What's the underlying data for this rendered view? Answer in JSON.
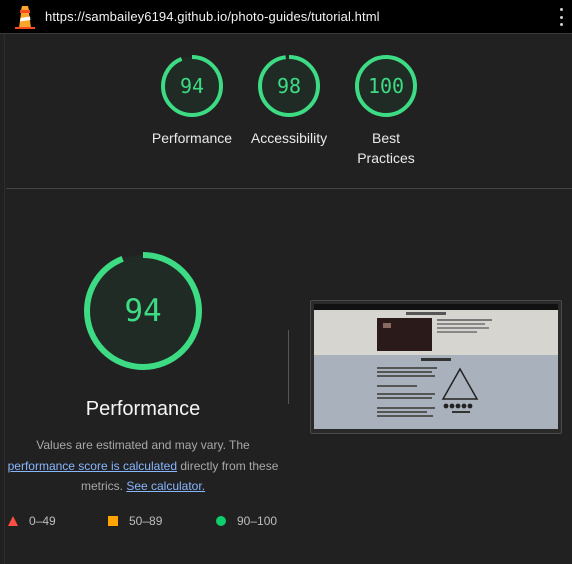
{
  "browser": {
    "url": "https://sambailey6194.github.io/photo-guides/tutorial.html"
  },
  "summary": [
    {
      "score": "94",
      "label": "Performance"
    },
    {
      "score": "98",
      "label": "Accessibility"
    },
    {
      "score": "100",
      "label": "Best Practices"
    }
  ],
  "performance": {
    "score": "94",
    "title": "Performance",
    "desc_1": "Values are estimated and may vary. The",
    "link_score": "performance score is calculated",
    "desc_2": "directly from these metrics.",
    "link_calc": "See calculator."
  },
  "legend": [
    {
      "range": "0–49",
      "color": "#ff4e42"
    },
    {
      "range": "50–89",
      "color": "#ffa400"
    },
    {
      "range": "90–100",
      "color": "#0cce6b"
    }
  ],
  "colors": {
    "pass": "#3ddc84",
    "background": "#212121"
  }
}
